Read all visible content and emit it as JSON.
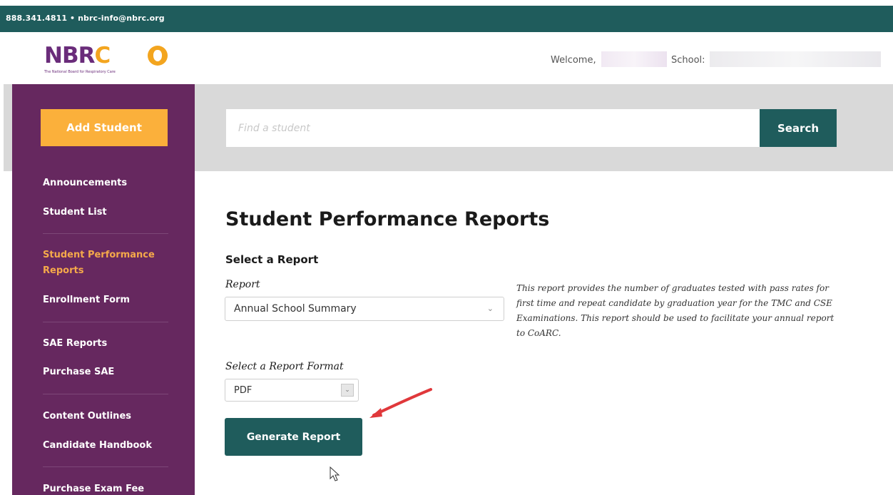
{
  "topbar": {
    "contact": "888.341.4811 • nbrc-info@nbrc.org"
  },
  "logo": {
    "wordmark_nbr": "NBR",
    "wordmark_c": "C",
    "tagline": "The National Board for Respiratory Care"
  },
  "header": {
    "welcome_label": "Welcome,",
    "school_label": "School:"
  },
  "search": {
    "placeholder": "Find a student",
    "button_label": "Search"
  },
  "sidebar": {
    "add_student_label": "Add Student",
    "items": [
      {
        "label": "Announcements"
      },
      {
        "label": "Student List"
      },
      {
        "label": "Student Performance Reports",
        "active": true
      },
      {
        "label": "Enrollment Form"
      },
      {
        "label": "SAE Reports"
      },
      {
        "label": "Purchase SAE"
      },
      {
        "label": "Content Outlines"
      },
      {
        "label": "Candidate Handbook"
      },
      {
        "label": "Purchase Exam Fee"
      }
    ]
  },
  "main": {
    "title": "Student Performance Reports",
    "section_title": "Select a Report",
    "report_label": "Report",
    "report_value": "Annual School Summary",
    "description": "This report provides the number of graduates tested with pass rates for first time and repeat candidate by graduation year for the TMC and CSE Examinations. This report should be used to facilitate your annual report to CoARC.",
    "format_label": "Select a Report Format",
    "format_value": "PDF",
    "generate_label": "Generate Report"
  },
  "colors": {
    "teal": "#1f5c5c",
    "purple": "#66285f",
    "orange": "#fbb03b",
    "active_link": "#f5a94a",
    "arrow": "#e0383b"
  }
}
